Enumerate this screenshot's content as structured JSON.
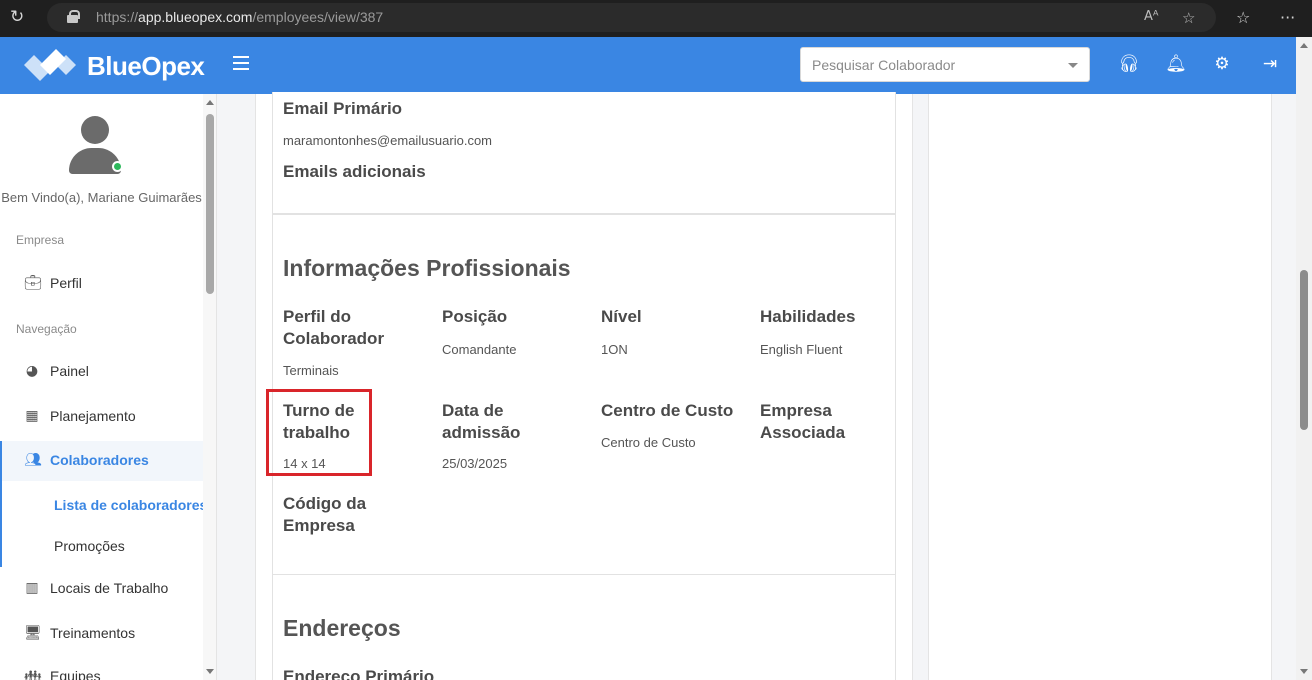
{
  "browser": {
    "url_prefix": "https://",
    "url_host": "app.blueopex.com",
    "url_path": "/employees/view/387"
  },
  "header": {
    "brand": "BlueOpex",
    "search_placeholder": "Pesquisar Colaborador",
    "icons": [
      "headset-icon",
      "bell-icon",
      "gear-icon",
      "logout-icon"
    ],
    "accent_color": "#3a86e3"
  },
  "sidebar": {
    "welcome": "Bem Vindo(a), Mariane Guimarães",
    "section_empresa": "Empresa",
    "section_navegacao": "Navegação",
    "items": [
      {
        "label": "Perfil",
        "icon": "briefcase-icon"
      },
      {
        "label": "Painel",
        "icon": "dashboard-icon"
      },
      {
        "label": "Planejamento",
        "icon": "calendar-icon"
      },
      {
        "label": "Colaboradores",
        "icon": "users-icon"
      },
      {
        "label": "Locais de Trabalho",
        "icon": "building-icon"
      },
      {
        "label": "Treinamentos",
        "icon": "training-icon"
      },
      {
        "label": "Equipes",
        "icon": "team-icon"
      }
    ],
    "sub_items": [
      "Lista de colaboradores",
      "Promoções"
    ]
  },
  "contact": {
    "email_primary_label": "Email Primário",
    "email_primary_value": "maramontonhes@emailusuario.com",
    "emails_additional_label": "Emails adicionais"
  },
  "professional": {
    "title": "Informações Profissionais",
    "fields": [
      {
        "label": "Perfil do Colaborador",
        "value": "Terminais"
      },
      {
        "label": "Posição",
        "value": "Comandante"
      },
      {
        "label": "Nível",
        "value": "1ON"
      },
      {
        "label": "Habilidades",
        "value": "English Fluent"
      },
      {
        "label": "Turno de trabalho",
        "value": "14 x 14"
      },
      {
        "label": "Data de admissão",
        "value": "25/03/2025"
      },
      {
        "label": "Centro de Custo",
        "value": "Centro de Custo"
      },
      {
        "label": "Empresa Associada",
        "value": ""
      },
      {
        "label": "Código da Empresa",
        "value": ""
      }
    ]
  },
  "addresses": {
    "title": "Endereços",
    "primary_label": "Endereço Primário"
  }
}
